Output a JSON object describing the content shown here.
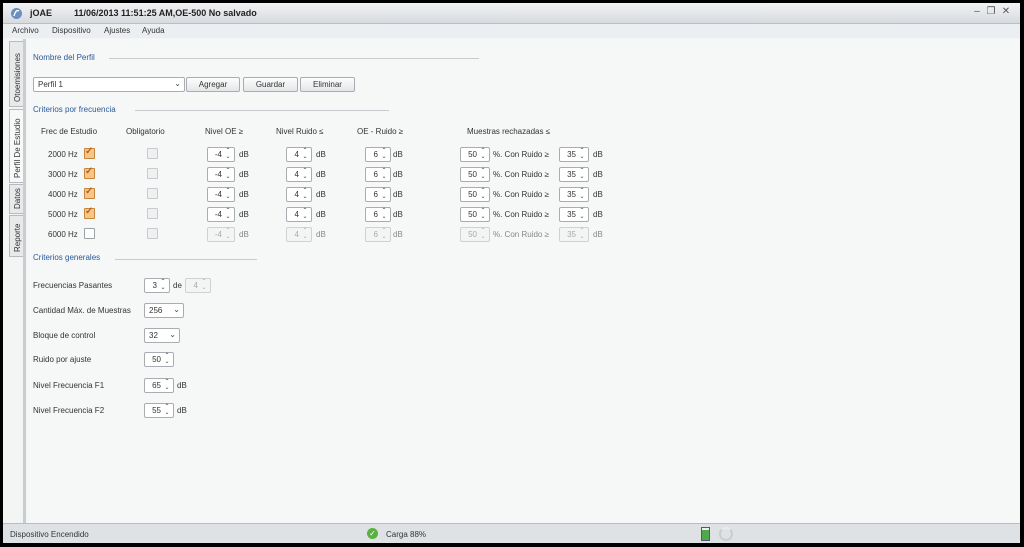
{
  "window": {
    "app_name": "jOAE",
    "document_title": "11/06/2013 11:51:25 AM,OE-500 No salvado",
    "controls": {
      "minimize": "–",
      "restore": "❐",
      "close": "✕"
    }
  },
  "menu": [
    "Archivo",
    "Dispositivo",
    "Ajustes",
    "Ayuda"
  ],
  "side_tabs": [
    {
      "label": "Otoemisiones",
      "active": false
    },
    {
      "label": "Perfil De Estudio",
      "active": true
    },
    {
      "label": "Datos",
      "active": false
    },
    {
      "label": "Reporte",
      "active": false
    }
  ],
  "profile": {
    "section_title": "Nombre del Perfil",
    "selected": "Perfil 1",
    "buttons": {
      "add": "Agregar",
      "save": "Guardar",
      "delete": "Eliminar"
    }
  },
  "freq_criteria": {
    "section_title": "Criterios por frecuencia",
    "headers": {
      "freq": "Frec de Estudio",
      "mandatory": "Obligatorio",
      "oe_level": "Nivel OE ≥",
      "noise_level": "Nivel Ruido ≤",
      "oe_minus_noise": "OE - Ruido ≥",
      "rejected": "Muestras rechazadas ≤"
    },
    "units": {
      "db": "dB",
      "pct_with_noise": "%. Con Ruido ≥"
    },
    "rows": [
      {
        "freq": "2000 Hz",
        "enabled": true,
        "oe": "-4",
        "noise": "4",
        "diff": "6",
        "rejected": "50",
        "with_noise": "35"
      },
      {
        "freq": "3000 Hz",
        "enabled": true,
        "oe": "-4",
        "noise": "4",
        "diff": "6",
        "rejected": "50",
        "with_noise": "35"
      },
      {
        "freq": "4000 Hz",
        "enabled": true,
        "oe": "-4",
        "noise": "4",
        "diff": "6",
        "rejected": "50",
        "with_noise": "35"
      },
      {
        "freq": "5000 Hz",
        "enabled": true,
        "oe": "-4",
        "noise": "4",
        "diff": "6",
        "rejected": "50",
        "with_noise": "35"
      },
      {
        "freq": "6000 Hz",
        "enabled": false,
        "oe": "-4",
        "noise": "4",
        "diff": "6",
        "rejected": "50",
        "with_noise": "35"
      }
    ]
  },
  "general": {
    "section_title": "Criterios generales",
    "passing_freqs": {
      "label": "Frecuencias Pasantes",
      "value": "3",
      "of": "de",
      "total": "4"
    },
    "max_samples": {
      "label": "Cantidad Máx. de Muestras",
      "value": "256"
    },
    "control_block": {
      "label": "Bloque de control",
      "value": "32"
    },
    "noise_adjust": {
      "label": "Ruido por ajuste",
      "value": "50"
    },
    "f1": {
      "label": "Nivel Frecuencia F1",
      "value": "65",
      "unit": "dB"
    },
    "f2": {
      "label": "Nivel Frecuencia F2",
      "value": "55",
      "unit": "dB"
    }
  },
  "status": {
    "device": "Dispositivo Encendido",
    "charge": "Carga 88%"
  }
}
